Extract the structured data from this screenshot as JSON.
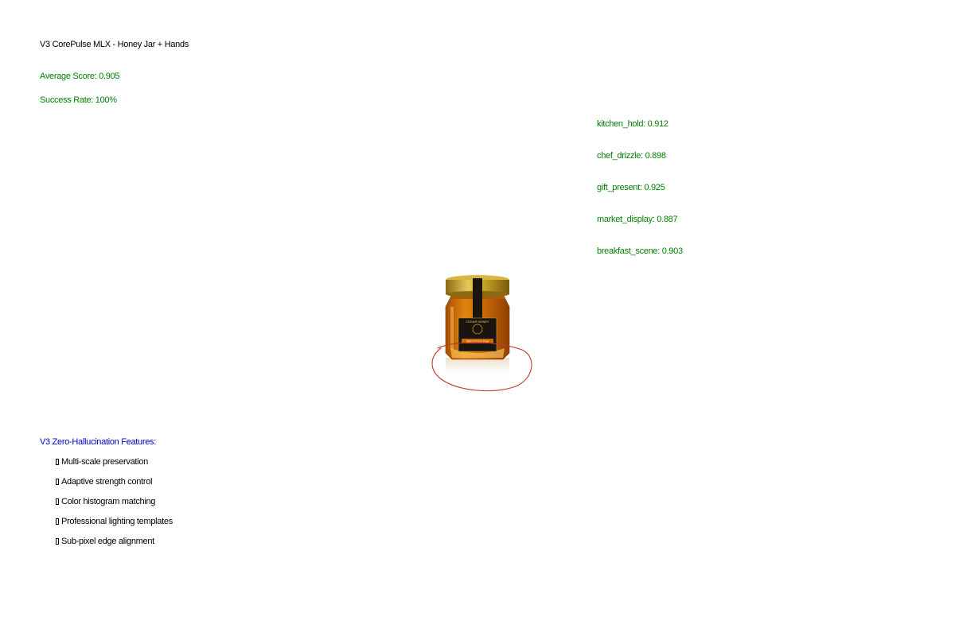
{
  "header": {
    "title": "V3 CorePulse MLX - Honey Jar + Hands",
    "average_score": "Average Score: 0.905",
    "success_rate": "Success Rate: 100%"
  },
  "scores": [
    "kitchen_hold: 0.912",
    "chef_drizzle: 0.898",
    "gift_present: 0.925",
    "market_display: 0.887",
    "breakfast_scene: 0.903"
  ],
  "figure": {
    "label_brand": "CEDAR HONEY",
    "label_sub": "Natural Pure Raw"
  },
  "features": {
    "heading": "V3 Zero-Hallucination Features:",
    "items": [
      "Multi-scale preservation",
      "Adaptive strength control",
      "Color histogram matching",
      "Professional lighting templates",
      "Sub-pixel edge alignment"
    ]
  },
  "colors": {
    "scores": "#008000",
    "heading": "#0000cc",
    "honey": "#c96a08",
    "lid_gold": "#c9a227",
    "annotation_circle": "#c0392b"
  }
}
